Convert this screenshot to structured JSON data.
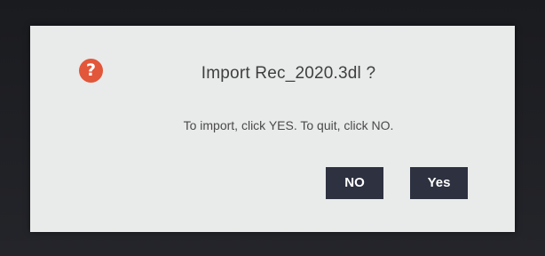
{
  "dialog": {
    "icon": "question-icon",
    "icon_glyph": "?",
    "title": "Import Rec_2020.3dl ?",
    "message": "To import, click  YES. To quit, click NO.",
    "no_label": "NO",
    "yes_label": "Yes"
  },
  "colors": {
    "background": "#1c1d21",
    "dialog": "#e9eaea",
    "icon": "#e2563a",
    "button": "#2d3140",
    "button_text": "#ffffff"
  }
}
